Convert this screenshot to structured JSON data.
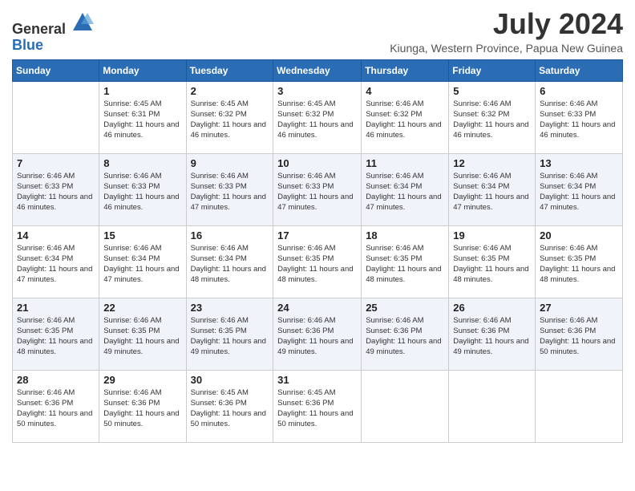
{
  "header": {
    "logo_general": "General",
    "logo_blue": "Blue",
    "month_year": "July 2024",
    "location": "Kiunga, Western Province, Papua New Guinea"
  },
  "days_of_week": [
    "Sunday",
    "Monday",
    "Tuesday",
    "Wednesday",
    "Thursday",
    "Friday",
    "Saturday"
  ],
  "weeks": [
    [
      {
        "day": "",
        "sunrise": "",
        "sunset": "",
        "daylight": ""
      },
      {
        "day": "1",
        "sunrise": "Sunrise: 6:45 AM",
        "sunset": "Sunset: 6:31 PM",
        "daylight": "Daylight: 11 hours and 46 minutes."
      },
      {
        "day": "2",
        "sunrise": "Sunrise: 6:45 AM",
        "sunset": "Sunset: 6:32 PM",
        "daylight": "Daylight: 11 hours and 46 minutes."
      },
      {
        "day": "3",
        "sunrise": "Sunrise: 6:45 AM",
        "sunset": "Sunset: 6:32 PM",
        "daylight": "Daylight: 11 hours and 46 minutes."
      },
      {
        "day": "4",
        "sunrise": "Sunrise: 6:46 AM",
        "sunset": "Sunset: 6:32 PM",
        "daylight": "Daylight: 11 hours and 46 minutes."
      },
      {
        "day": "5",
        "sunrise": "Sunrise: 6:46 AM",
        "sunset": "Sunset: 6:32 PM",
        "daylight": "Daylight: 11 hours and 46 minutes."
      },
      {
        "day": "6",
        "sunrise": "Sunrise: 6:46 AM",
        "sunset": "Sunset: 6:33 PM",
        "daylight": "Daylight: 11 hours and 46 minutes."
      }
    ],
    [
      {
        "day": "7",
        "sunrise": "Sunrise: 6:46 AM",
        "sunset": "Sunset: 6:33 PM",
        "daylight": "Daylight: 11 hours and 46 minutes."
      },
      {
        "day": "8",
        "sunrise": "Sunrise: 6:46 AM",
        "sunset": "Sunset: 6:33 PM",
        "daylight": "Daylight: 11 hours and 46 minutes."
      },
      {
        "day": "9",
        "sunrise": "Sunrise: 6:46 AM",
        "sunset": "Sunset: 6:33 PM",
        "daylight": "Daylight: 11 hours and 47 minutes."
      },
      {
        "day": "10",
        "sunrise": "Sunrise: 6:46 AM",
        "sunset": "Sunset: 6:33 PM",
        "daylight": "Daylight: 11 hours and 47 minutes."
      },
      {
        "day": "11",
        "sunrise": "Sunrise: 6:46 AM",
        "sunset": "Sunset: 6:34 PM",
        "daylight": "Daylight: 11 hours and 47 minutes."
      },
      {
        "day": "12",
        "sunrise": "Sunrise: 6:46 AM",
        "sunset": "Sunset: 6:34 PM",
        "daylight": "Daylight: 11 hours and 47 minutes."
      },
      {
        "day": "13",
        "sunrise": "Sunrise: 6:46 AM",
        "sunset": "Sunset: 6:34 PM",
        "daylight": "Daylight: 11 hours and 47 minutes."
      }
    ],
    [
      {
        "day": "14",
        "sunrise": "Sunrise: 6:46 AM",
        "sunset": "Sunset: 6:34 PM",
        "daylight": "Daylight: 11 hours and 47 minutes."
      },
      {
        "day": "15",
        "sunrise": "Sunrise: 6:46 AM",
        "sunset": "Sunset: 6:34 PM",
        "daylight": "Daylight: 11 hours and 47 minutes."
      },
      {
        "day": "16",
        "sunrise": "Sunrise: 6:46 AM",
        "sunset": "Sunset: 6:34 PM",
        "daylight": "Daylight: 11 hours and 48 minutes."
      },
      {
        "day": "17",
        "sunrise": "Sunrise: 6:46 AM",
        "sunset": "Sunset: 6:35 PM",
        "daylight": "Daylight: 11 hours and 48 minutes."
      },
      {
        "day": "18",
        "sunrise": "Sunrise: 6:46 AM",
        "sunset": "Sunset: 6:35 PM",
        "daylight": "Daylight: 11 hours and 48 minutes."
      },
      {
        "day": "19",
        "sunrise": "Sunrise: 6:46 AM",
        "sunset": "Sunset: 6:35 PM",
        "daylight": "Daylight: 11 hours and 48 minutes."
      },
      {
        "day": "20",
        "sunrise": "Sunrise: 6:46 AM",
        "sunset": "Sunset: 6:35 PM",
        "daylight": "Daylight: 11 hours and 48 minutes."
      }
    ],
    [
      {
        "day": "21",
        "sunrise": "Sunrise: 6:46 AM",
        "sunset": "Sunset: 6:35 PM",
        "daylight": "Daylight: 11 hours and 48 minutes."
      },
      {
        "day": "22",
        "sunrise": "Sunrise: 6:46 AM",
        "sunset": "Sunset: 6:35 PM",
        "daylight": "Daylight: 11 hours and 49 minutes."
      },
      {
        "day": "23",
        "sunrise": "Sunrise: 6:46 AM",
        "sunset": "Sunset: 6:35 PM",
        "daylight": "Daylight: 11 hours and 49 minutes."
      },
      {
        "day": "24",
        "sunrise": "Sunrise: 6:46 AM",
        "sunset": "Sunset: 6:36 PM",
        "daylight": "Daylight: 11 hours and 49 minutes."
      },
      {
        "day": "25",
        "sunrise": "Sunrise: 6:46 AM",
        "sunset": "Sunset: 6:36 PM",
        "daylight": "Daylight: 11 hours and 49 minutes."
      },
      {
        "day": "26",
        "sunrise": "Sunrise: 6:46 AM",
        "sunset": "Sunset: 6:36 PM",
        "daylight": "Daylight: 11 hours and 49 minutes."
      },
      {
        "day": "27",
        "sunrise": "Sunrise: 6:46 AM",
        "sunset": "Sunset: 6:36 PM",
        "daylight": "Daylight: 11 hours and 50 minutes."
      }
    ],
    [
      {
        "day": "28",
        "sunrise": "Sunrise: 6:46 AM",
        "sunset": "Sunset: 6:36 PM",
        "daylight": "Daylight: 11 hours and 50 minutes."
      },
      {
        "day": "29",
        "sunrise": "Sunrise: 6:46 AM",
        "sunset": "Sunset: 6:36 PM",
        "daylight": "Daylight: 11 hours and 50 minutes."
      },
      {
        "day": "30",
        "sunrise": "Sunrise: 6:45 AM",
        "sunset": "Sunset: 6:36 PM",
        "daylight": "Daylight: 11 hours and 50 minutes."
      },
      {
        "day": "31",
        "sunrise": "Sunrise: 6:45 AM",
        "sunset": "Sunset: 6:36 PM",
        "daylight": "Daylight: 11 hours and 50 minutes."
      },
      {
        "day": "",
        "sunrise": "",
        "sunset": "",
        "daylight": ""
      },
      {
        "day": "",
        "sunrise": "",
        "sunset": "",
        "daylight": ""
      },
      {
        "day": "",
        "sunrise": "",
        "sunset": "",
        "daylight": ""
      }
    ]
  ]
}
